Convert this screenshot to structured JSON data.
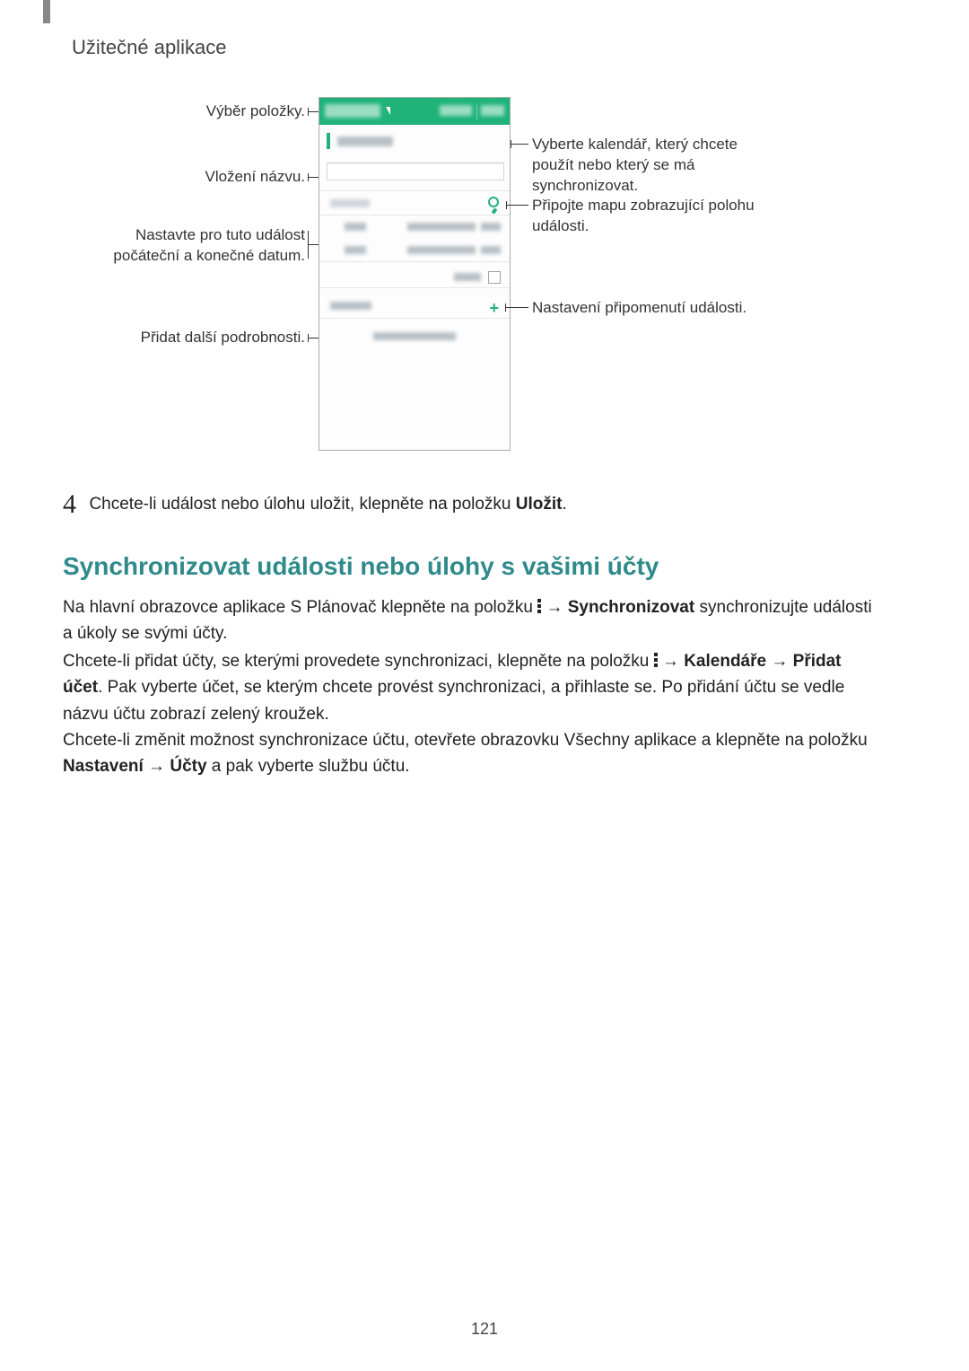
{
  "header": {
    "section": "Užitečné aplikace"
  },
  "callouts": {
    "left1": "Výběr položky.",
    "left2": "Vložení názvu.",
    "left3": "Nastavte pro tuto událost počáteční a konečné datum.",
    "left4": "Přidat další podrobnosti.",
    "right1": "Vyberte kalendář, který chcete použít nebo který se má synchronizovat.",
    "right2": "Připojte mapu zobrazující polohu události.",
    "right3": "Nastavení připomenutí události."
  },
  "step4": {
    "num": "4",
    "text_before": "Chcete-li událost nebo úlohu uložit, klepněte na položku ",
    "bold": "Uložit",
    "text_after": "."
  },
  "heading": "Synchronizovat události nebo úlohy s vašimi účty",
  "para1": {
    "a": "Na hlavní obrazovce aplikace S Plánovač klepněte na položku ",
    "arrow": " → ",
    "b_bold": "Synchronizovat",
    "c": " synchronizujte události a úkoly se svými účty."
  },
  "para2": {
    "a": "Chcete-li přidat účty, se kterými provedete synchronizaci, klepněte na položku ",
    "arrow": " → ",
    "b_bold": "Kalendáře",
    "arrow2": " → ",
    "c_bold": "Přidat účet",
    "d": ". Pak vyberte účet, se kterým chcete provést synchronizaci, a přihlaste se. Po přidání účtu se vedle názvu účtu zobrazí zelený kroužek."
  },
  "para3": {
    "a": "Chcete-li změnit možnost synchronizace účtu, otevřete obrazovku Všechny aplikace a klepněte na položku ",
    "b_bold": "Nastavení",
    "arrow": " → ",
    "c_bold": "Účty",
    "d": " a pak vyberte službu účtu."
  },
  "page_number": "121"
}
